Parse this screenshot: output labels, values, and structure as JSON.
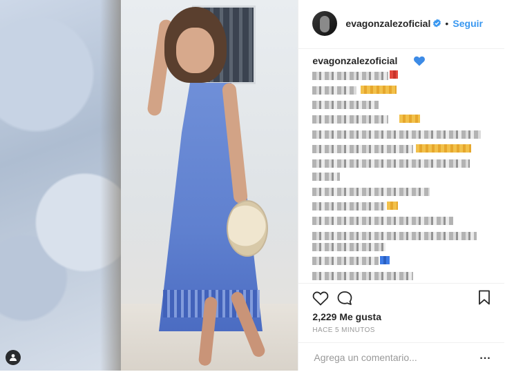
{
  "post": {
    "username": "evagonzalezoficial",
    "follow_separator": "•",
    "follow_label": "Seguir",
    "caption_user": "evagonzalezoficial",
    "likes_text": "2,229 Me gusta",
    "time_text": "HACE 5 MINUTOS",
    "comment_placeholder": "Agrega un comentario...",
    "more_label": "...",
    "accent_color": "#3897f0"
  },
  "icons": {
    "verified": "verified-badge-icon",
    "caption_heart": "blue-heart-icon",
    "like": "heart-outline-icon",
    "comment": "comment-bubble-icon",
    "save": "bookmark-icon",
    "tag": "user-tag-icon"
  }
}
